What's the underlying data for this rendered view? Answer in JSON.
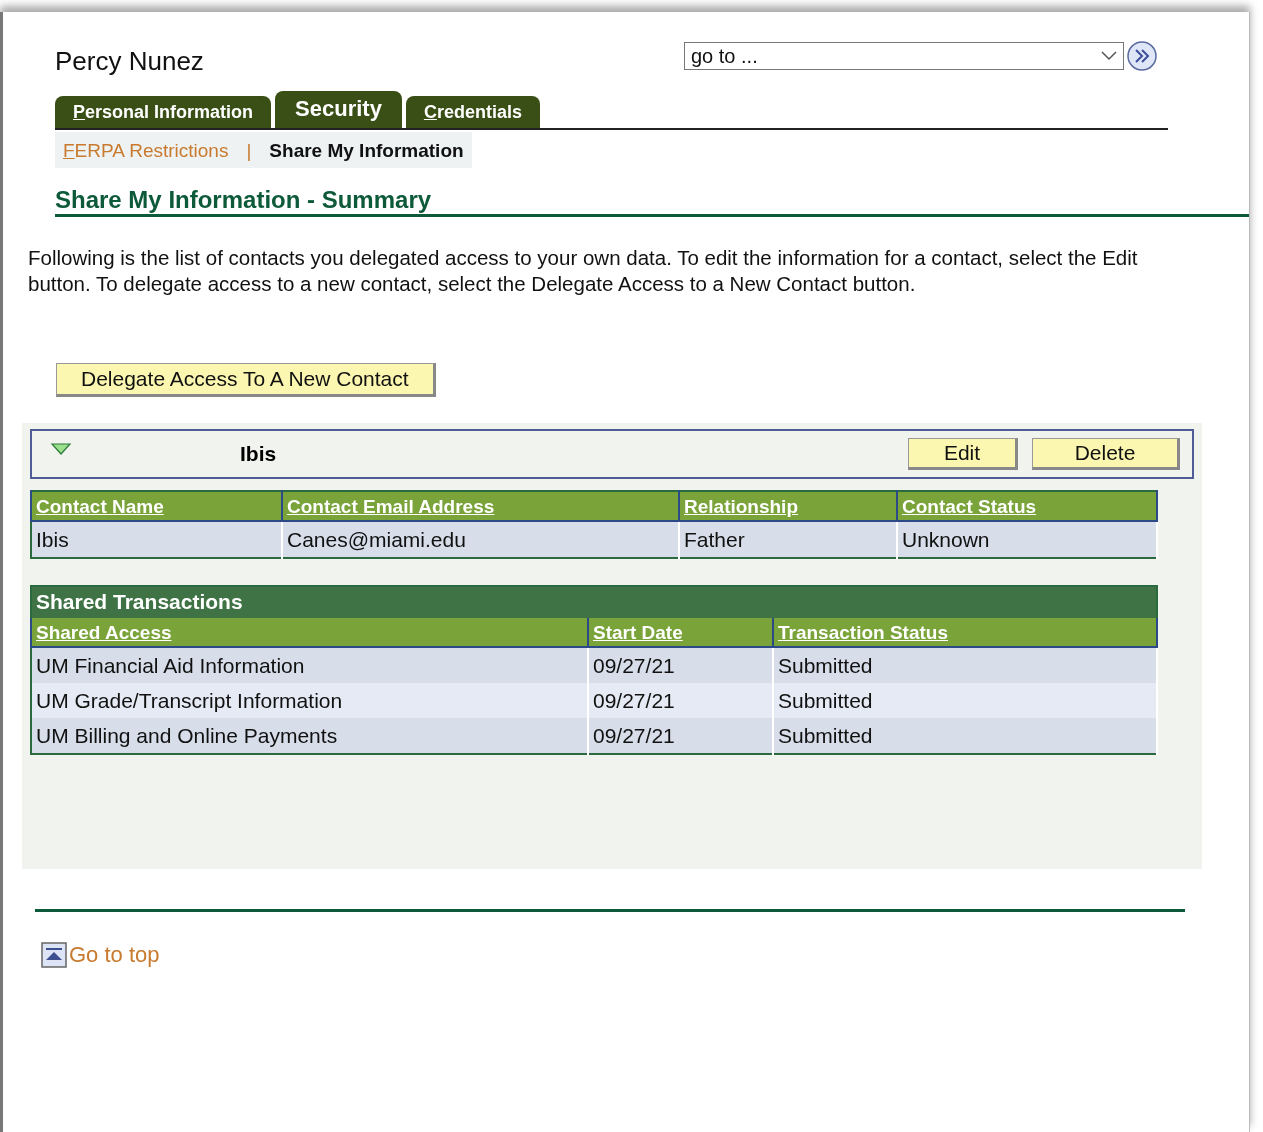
{
  "header": {
    "user_name": "Percy Nunez",
    "goto": {
      "placeholder": "go to ..."
    }
  },
  "tabs": [
    {
      "label": "Personal Information",
      "selected": false,
      "hotkey_first": true
    },
    {
      "label": "Security",
      "selected": true,
      "hotkey_first": false
    },
    {
      "label": "Credentials",
      "selected": false,
      "hotkey_first": true
    }
  ],
  "subnav": [
    {
      "label": "FERPA Restrictions",
      "selected": false,
      "hotkey_first": true
    },
    {
      "label": "Share My Information",
      "selected": true,
      "hotkey_first": false
    }
  ],
  "subnav_separator": "|",
  "page_title": "Share My Information - Summary",
  "instructions": "Following is the list of contacts you delegated access to your own data. To edit the information for a contact, select the Edit button. To delegate access to a new contact, select the Delegate Access to a New Contact button.",
  "delegate_button": "Delegate Access To A New Contact",
  "contact": {
    "name": "Ibis",
    "expanded": true,
    "buttons": [
      "Edit",
      "Delete"
    ],
    "table": {
      "columns": [
        "Contact Name",
        "Contact Email Address",
        "Relationship",
        "Contact Status"
      ],
      "rows": [
        [
          "Ibis",
          "Canes@miami.edu",
          "Father",
          "Unknown"
        ]
      ]
    },
    "transactions": {
      "title": "Shared Transactions",
      "columns": [
        "Shared Access",
        "Start Date",
        "Transaction Status"
      ],
      "rows": [
        [
          "UM Financial Aid Information",
          "09/27/21",
          "Submitted"
        ],
        [
          "UM Grade/Transcript Information",
          "09/27/21",
          "Submitted"
        ],
        [
          "UM Billing and Online Payments",
          "09/27/21",
          "Submitted"
        ]
      ]
    }
  },
  "footer": {
    "go_to_top": "Go to top"
  }
}
